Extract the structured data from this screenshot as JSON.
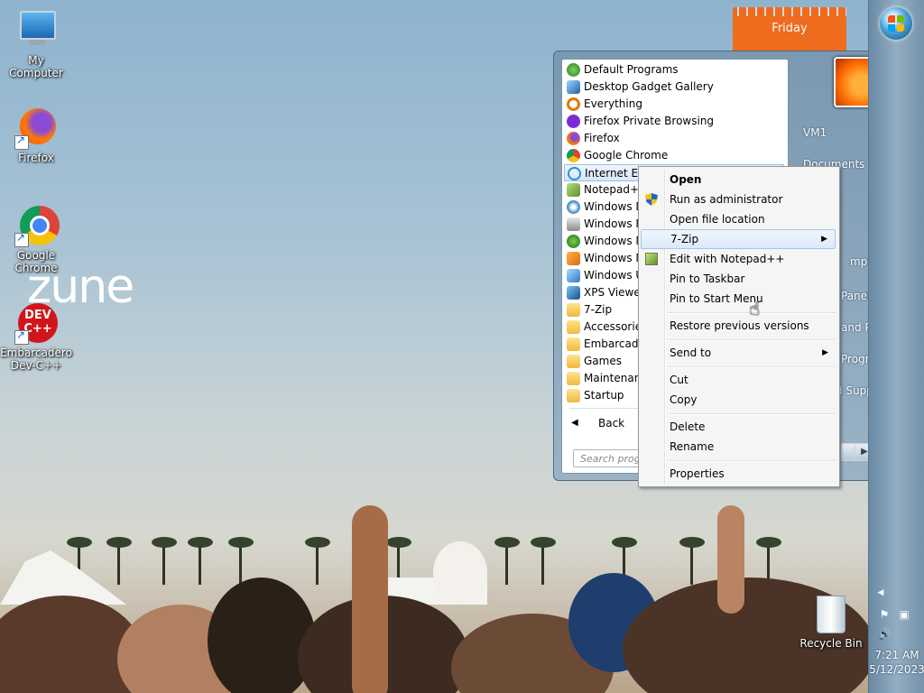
{
  "desktop": {
    "icons": [
      {
        "label": "My Computer"
      },
      {
        "label": "Firefox"
      },
      {
        "label": "Google Chrome"
      },
      {
        "label": "Embarcadero Dev-C++"
      }
    ],
    "wallpaper_logo": "zune",
    "recycle_bin": "Recycle Bin",
    "calendar_day": "Friday"
  },
  "start_menu": {
    "programs": [
      {
        "label": "Default Programs",
        "icon": "default-programs-icon"
      },
      {
        "label": "Desktop Gadget Gallery",
        "icon": "gadget-icon"
      },
      {
        "label": "Everything",
        "icon": "search-magnifier-icon"
      },
      {
        "label": "Firefox Private Browsing",
        "icon": "firefox-private-icon"
      },
      {
        "label": "Firefox",
        "icon": "firefox-icon"
      },
      {
        "label": "Google Chrome",
        "icon": "chrome-icon"
      },
      {
        "label": "Internet Exp",
        "icon": "internet-explorer-icon"
      },
      {
        "label": "Notepad++",
        "icon": "notepad-plus-plus-icon"
      },
      {
        "label": "Windows D",
        "icon": "windows-dvd-icon"
      },
      {
        "label": "Windows Fa",
        "icon": "windows-fax-icon"
      },
      {
        "label": "Windows M",
        "icon": "windows-media-center-icon"
      },
      {
        "label": "Windows M",
        "icon": "windows-media-player-icon"
      },
      {
        "label": "Windows U",
        "icon": "windows-update-icon"
      },
      {
        "label": "XPS Viewer",
        "icon": "xps-viewer-icon"
      },
      {
        "label": "7-Zip",
        "icon": "folder-icon"
      },
      {
        "label": "Accessories",
        "icon": "folder-icon"
      },
      {
        "label": "Embarcader",
        "icon": "folder-icon"
      },
      {
        "label": "Games",
        "icon": "folder-icon"
      },
      {
        "label": "Maintenanc",
        "icon": "folder-icon"
      },
      {
        "label": "Startup",
        "icon": "folder-icon"
      }
    ],
    "back_label": "Back",
    "search_placeholder": "Search prog",
    "right_links": [
      {
        "label": "VM1"
      },
      {
        "label": "Documents"
      },
      {
        "label": "mputer"
      },
      {
        "label": "Panel"
      },
      {
        "label": "and Printers"
      },
      {
        "label": "Programs"
      },
      {
        "label": "d Support"
      }
    ]
  },
  "context_menu": {
    "items": [
      {
        "label": "Open",
        "bold": true
      },
      {
        "label": "Run as administrator",
        "icon": "uac-shield-icon"
      },
      {
        "label": "Open file location"
      },
      {
        "label": "7-Zip",
        "submenu": true,
        "highlighted": true
      },
      {
        "label": "Edit with Notepad++",
        "icon": "notepad-plus-plus-icon"
      },
      {
        "label": "Pin to Taskbar"
      },
      {
        "label": "Pin to Start Menu"
      },
      {
        "label": "Restore previous versions"
      },
      {
        "label": "Send to",
        "submenu": true
      },
      {
        "label": "Cut"
      },
      {
        "label": "Copy"
      },
      {
        "label": "Delete"
      },
      {
        "label": "Rename"
      },
      {
        "label": "Properties"
      }
    ]
  },
  "taskbar": {
    "time": "7:21 AM",
    "date": "5/12/2023"
  }
}
